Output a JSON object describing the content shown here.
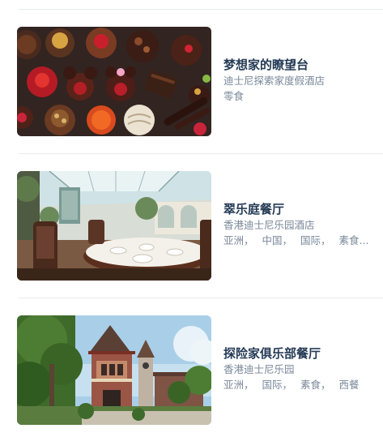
{
  "list": [
    {
      "title": "梦想家的瞭望台",
      "location": "迪士尼探索家度假酒店",
      "tags": [
        "零食"
      ]
    },
    {
      "title": "翠乐庭餐厅",
      "location": "香港迪士尼乐园酒店",
      "tags": [
        "亚洲，",
        "中国，",
        "国际，",
        "素食..."
      ]
    },
    {
      "title": "探险家俱乐部餐厅",
      "location": "香港迪士尼乐园",
      "tags": [
        "亚洲，",
        "国际，",
        "素食，",
        "西餐"
      ]
    }
  ],
  "colors": {
    "title": "#253b56",
    "subtext": "#7a8899",
    "divider": "#e9ecf1"
  }
}
